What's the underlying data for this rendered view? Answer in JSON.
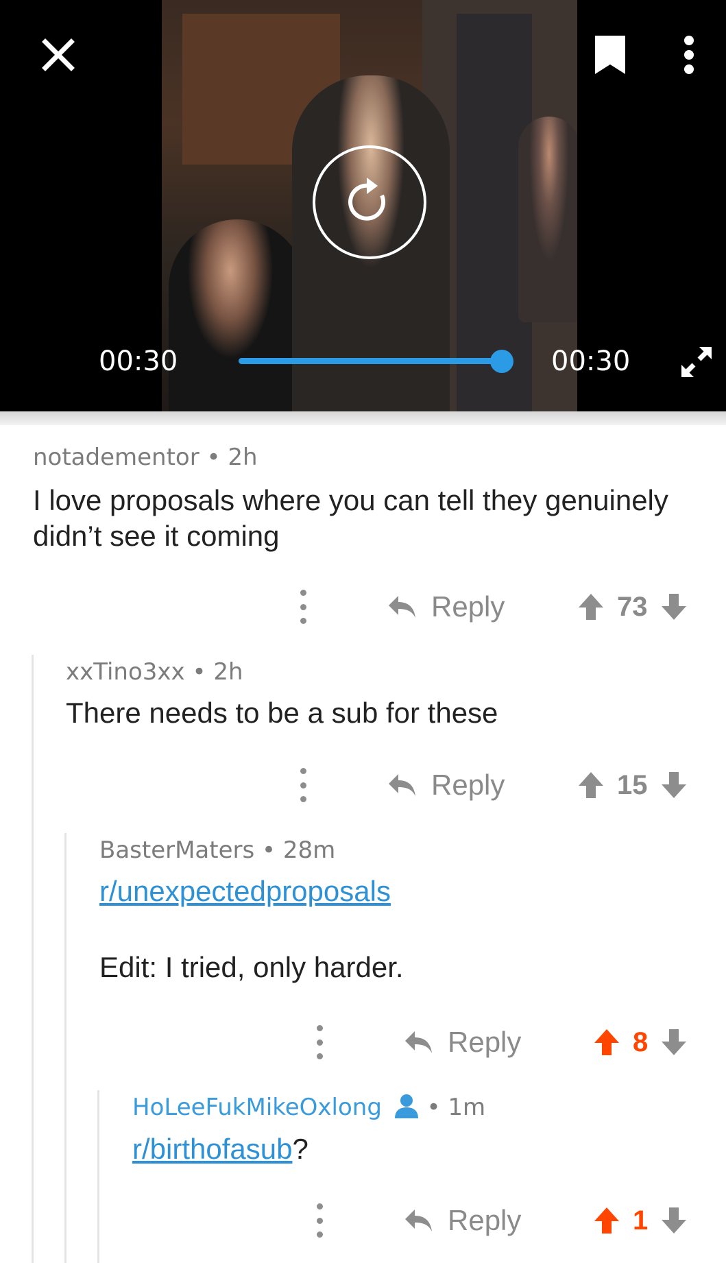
{
  "player": {
    "current_time": "00:30",
    "duration": "00:30",
    "progress_fraction": 1.0,
    "accent_color": "#2c9be6",
    "icons": [
      "close-icon",
      "bookmark-icon",
      "more-vertical-icon",
      "replay-icon",
      "fullscreen-icon"
    ]
  },
  "comments": [
    {
      "author": "notadementor",
      "age": "2h",
      "body": "I love proposals where you can tell they genuinely didn’t see it coming",
      "reply_label": "Reply",
      "score": "73",
      "upvoted": false
    },
    {
      "author": "xxTino3xx",
      "age": "2h",
      "body": "There needs to be a sub for these",
      "reply_label": "Reply",
      "score": "15",
      "upvoted": false
    },
    {
      "author": "BasterMaters",
      "age": "28m",
      "link": "r/unexpectedproposals",
      "body": "Edit: I tried, only harder.",
      "reply_label": "Reply",
      "score": "8",
      "upvoted": true
    },
    {
      "author": "HoLeeFukMikeOxlong",
      "is_op": true,
      "age": "1m",
      "link": "r/birthofasub",
      "body_suffix": "?",
      "reply_label": "Reply",
      "score": "1",
      "upvoted": true
    }
  ],
  "colors": {
    "upvote": "#ff4500",
    "link": "#2e91d6",
    "op_author": "#3a9bdc",
    "muted": "#8a8a8a"
  }
}
